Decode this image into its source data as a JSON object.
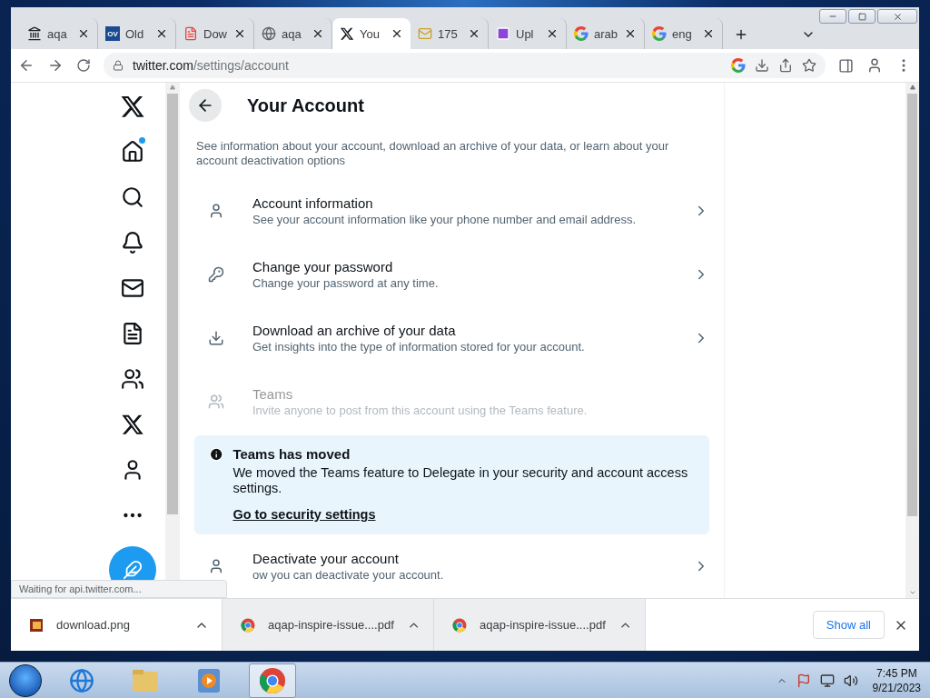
{
  "browser": {
    "tabs": [
      {
        "title": "aqa",
        "selected": false
      },
      {
        "title": "Old",
        "favicon_text": "OV",
        "selected": false
      },
      {
        "title": "Dow",
        "selected": false
      },
      {
        "title": "aqa",
        "selected": false
      },
      {
        "title": "You",
        "selected": true
      },
      {
        "title": "175",
        "selected": false
      },
      {
        "title": "Upl",
        "selected": false
      },
      {
        "title": "arab",
        "selected": false
      },
      {
        "title": "eng",
        "selected": false
      }
    ],
    "address": {
      "domain": "twitter.com",
      "path": "/settings/account"
    },
    "status": "Waiting for api.twitter.com..."
  },
  "nav": [
    {
      "unread": false
    },
    {
      "unread": true
    },
    {
      "unread": false
    },
    {
      "unread": false
    },
    {
      "unread": false
    },
    {
      "unread": false
    },
    {
      "unread": false
    },
    {
      "unread": false
    },
    {
      "unread": false
    },
    {
      "unread": false
    }
  ],
  "page": {
    "title": "Your Account",
    "description": "See information about your account, download an archive of your data, or learn about your account deactivation options",
    "rows": [
      {
        "title": "Account information",
        "subtitle": "See your account information like your phone number and email address.",
        "disabled": false
      },
      {
        "title": "Change your password",
        "subtitle": "Change your password at any time.",
        "disabled": false
      },
      {
        "title": "Download an archive of your data",
        "subtitle": "Get insights into the type of information stored for your account.",
        "disabled": false
      },
      {
        "title": "Teams",
        "subtitle": "Invite anyone to post from this account using the Teams feature.",
        "disabled": true
      }
    ],
    "notice": {
      "title": "Teams has moved",
      "text": "We moved the Teams feature to Delegate in your security and account access settings.",
      "link": "Go to security settings"
    },
    "last_row": {
      "title": "Deactivate your account",
      "subtitle": "ow you can deactivate your account.",
      "disabled": false
    }
  },
  "downloads": {
    "items": [
      {
        "name": "download.png"
      },
      {
        "name": "aqap-inspire-issue....pdf"
      },
      {
        "name": "aqap-inspire-issue....pdf"
      }
    ],
    "show_all": "Show all"
  },
  "taskbar": {
    "time": "7:45 PM",
    "date": "9/21/2023"
  }
}
